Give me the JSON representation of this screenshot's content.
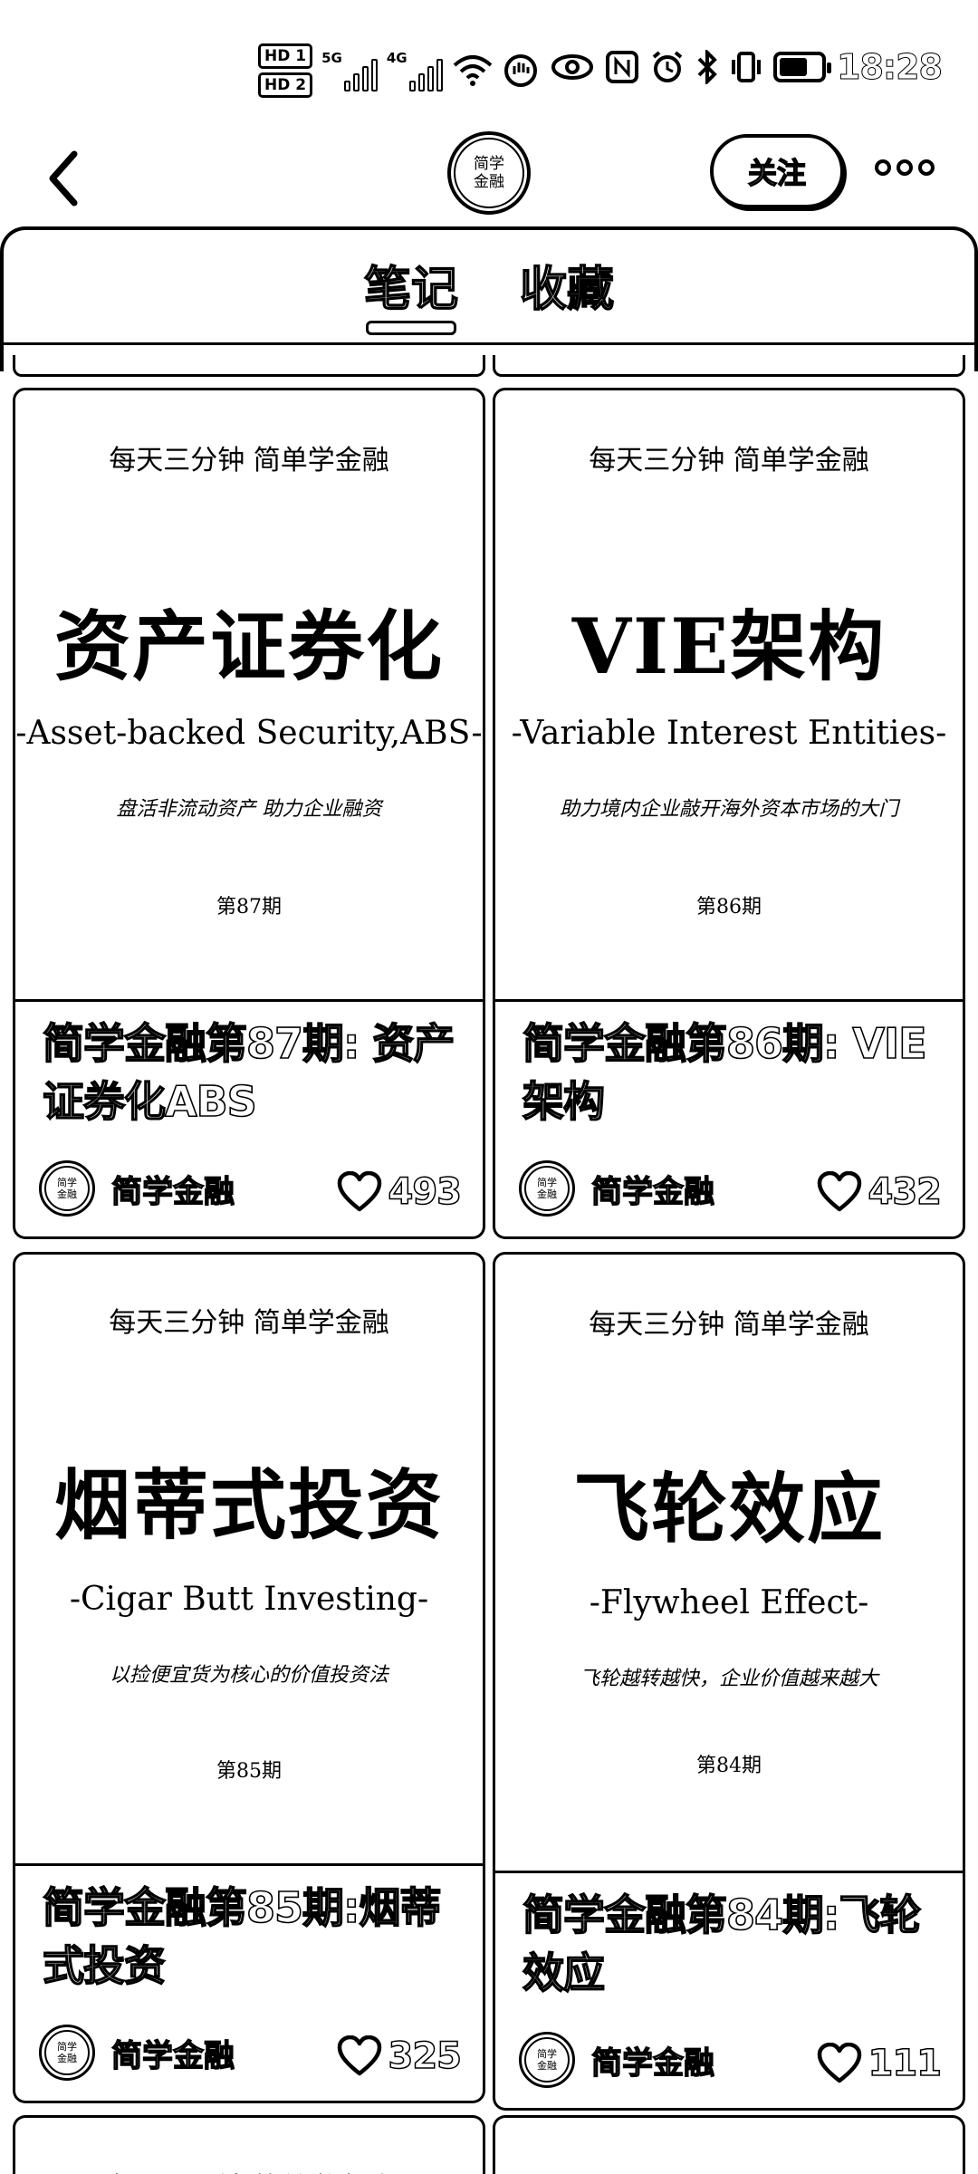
{
  "status_bar": {
    "hd1": "HD 1",
    "hd2": "HD 2",
    "net1": "5G",
    "net2": "4G",
    "time": "18:28"
  },
  "header": {
    "avatar_line1": "简学",
    "avatar_line2": "金融",
    "follow_label": "关注"
  },
  "tabs": [
    {
      "label": "笔记",
      "active": true
    },
    {
      "label": "收藏",
      "active": false
    }
  ],
  "notes": [
    {
      "cover_tag": "每天三分钟 简单学金融",
      "cover_title": "资产证券化",
      "cover_en": "-Asset-backed Security,ABS-",
      "cover_sub": "盘活非流动资产 助力企业融资",
      "cover_issue": "第87期",
      "title": "简学金融第87期: 资产证券化ABS",
      "author": "简学金融",
      "likes": "493"
    },
    {
      "cover_tag": "每天三分钟 简单学金融",
      "cover_title": "VIE架构",
      "cover_en": "-Variable Interest Entities-",
      "cover_sub": "助力境内企业敲开海外资本市场的大门",
      "cover_issue": "第86期",
      "title": "简学金融第86期: VIE架构",
      "author": "简学金融",
      "likes": "432"
    },
    {
      "cover_tag": "每天三分钟 简单学金融",
      "cover_title": "烟蒂式投资",
      "cover_en": "-Cigar Butt Investing-",
      "cover_sub": "以捡便宜货为核心的价值投资法",
      "cover_issue": "第85期",
      "title": "简学金融第85期:烟蒂式投资",
      "author": "简学金融",
      "likes": "325"
    },
    {
      "cover_tag": "每天三分钟 简单学金融",
      "cover_title": "飞轮效应",
      "cover_en": "-Flywheel Effect-",
      "cover_sub": "飞轮越转越快，企业价值越来越大",
      "cover_issue": "第84期",
      "title": "简学金融第84期:飞轮效应",
      "author": "简学金融",
      "likes": "111"
    }
  ],
  "next_peek": {
    "cover_tag": "每天三分钟 简单学金融"
  },
  "icons": {
    "back": "chevron-left-icon",
    "more": "more-dots-icon",
    "like": "heart-icon"
  }
}
